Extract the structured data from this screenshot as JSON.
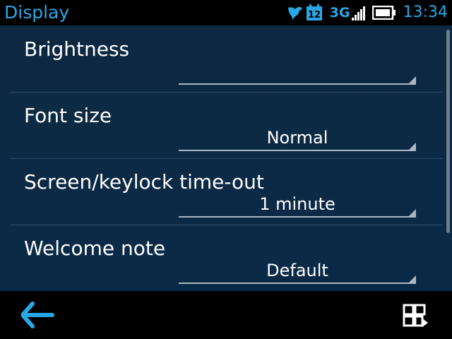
{
  "status_bar": {
    "title": "Display",
    "calendar_day": "12",
    "network": "3G",
    "time": "13:34",
    "accent_color": "#2aa6e6"
  },
  "settings": [
    {
      "label": "Brightness",
      "value": ""
    },
    {
      "label": "Font size",
      "value": "Normal"
    },
    {
      "label": "Screen/keylock time-out",
      "value": "1 minute"
    },
    {
      "label": "Welcome note",
      "value": "Default"
    }
  ],
  "toolbar": {
    "back_icon": "back-arrow-icon",
    "menu_icon": "options-menu-icon"
  }
}
